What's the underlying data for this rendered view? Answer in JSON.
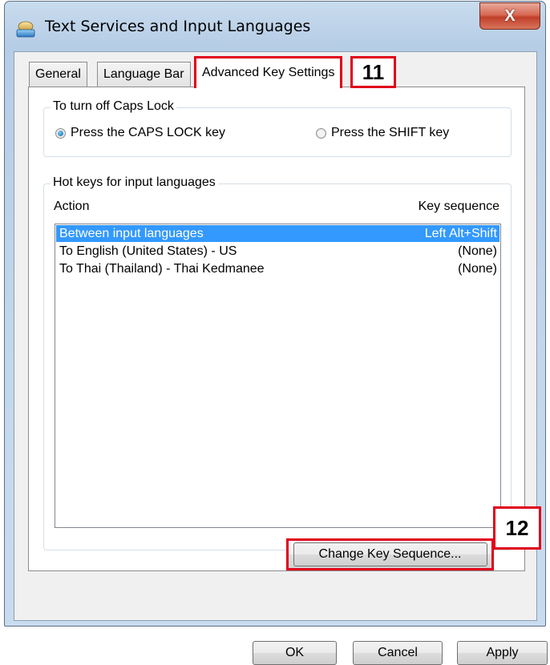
{
  "window": {
    "title": "Text Services and Input Languages",
    "close_label": "X"
  },
  "tabs": [
    {
      "label": "General"
    },
    {
      "label": "Language Bar"
    },
    {
      "label": "Advanced Key Settings"
    }
  ],
  "callouts": {
    "tab_marker": "11",
    "button_marker": "12"
  },
  "caps_lock": {
    "legend": "To turn off Caps Lock",
    "options": [
      {
        "label": "Press the CAPS LOCK key",
        "checked": true
      },
      {
        "label": "Press the SHIFT key",
        "checked": false
      }
    ]
  },
  "hotkeys": {
    "legend": "Hot keys for input languages",
    "columns": {
      "action": "Action",
      "sequence": "Key sequence"
    },
    "rows": [
      {
        "action": "Between input languages",
        "sequence": "Left Alt+Shift",
        "selected": true
      },
      {
        "action": "To English (United States) - US",
        "sequence": "(None)",
        "selected": false
      },
      {
        "action": "To Thai (Thailand) - Thai Kedmanee",
        "sequence": "(None)",
        "selected": false
      }
    ],
    "change_button": "Change Key Sequence..."
  },
  "footer": {
    "ok": "OK",
    "cancel": "Cancel",
    "apply": "Apply"
  },
  "colors": {
    "selection": "#3399ff",
    "callout_border": "#e0001b"
  }
}
